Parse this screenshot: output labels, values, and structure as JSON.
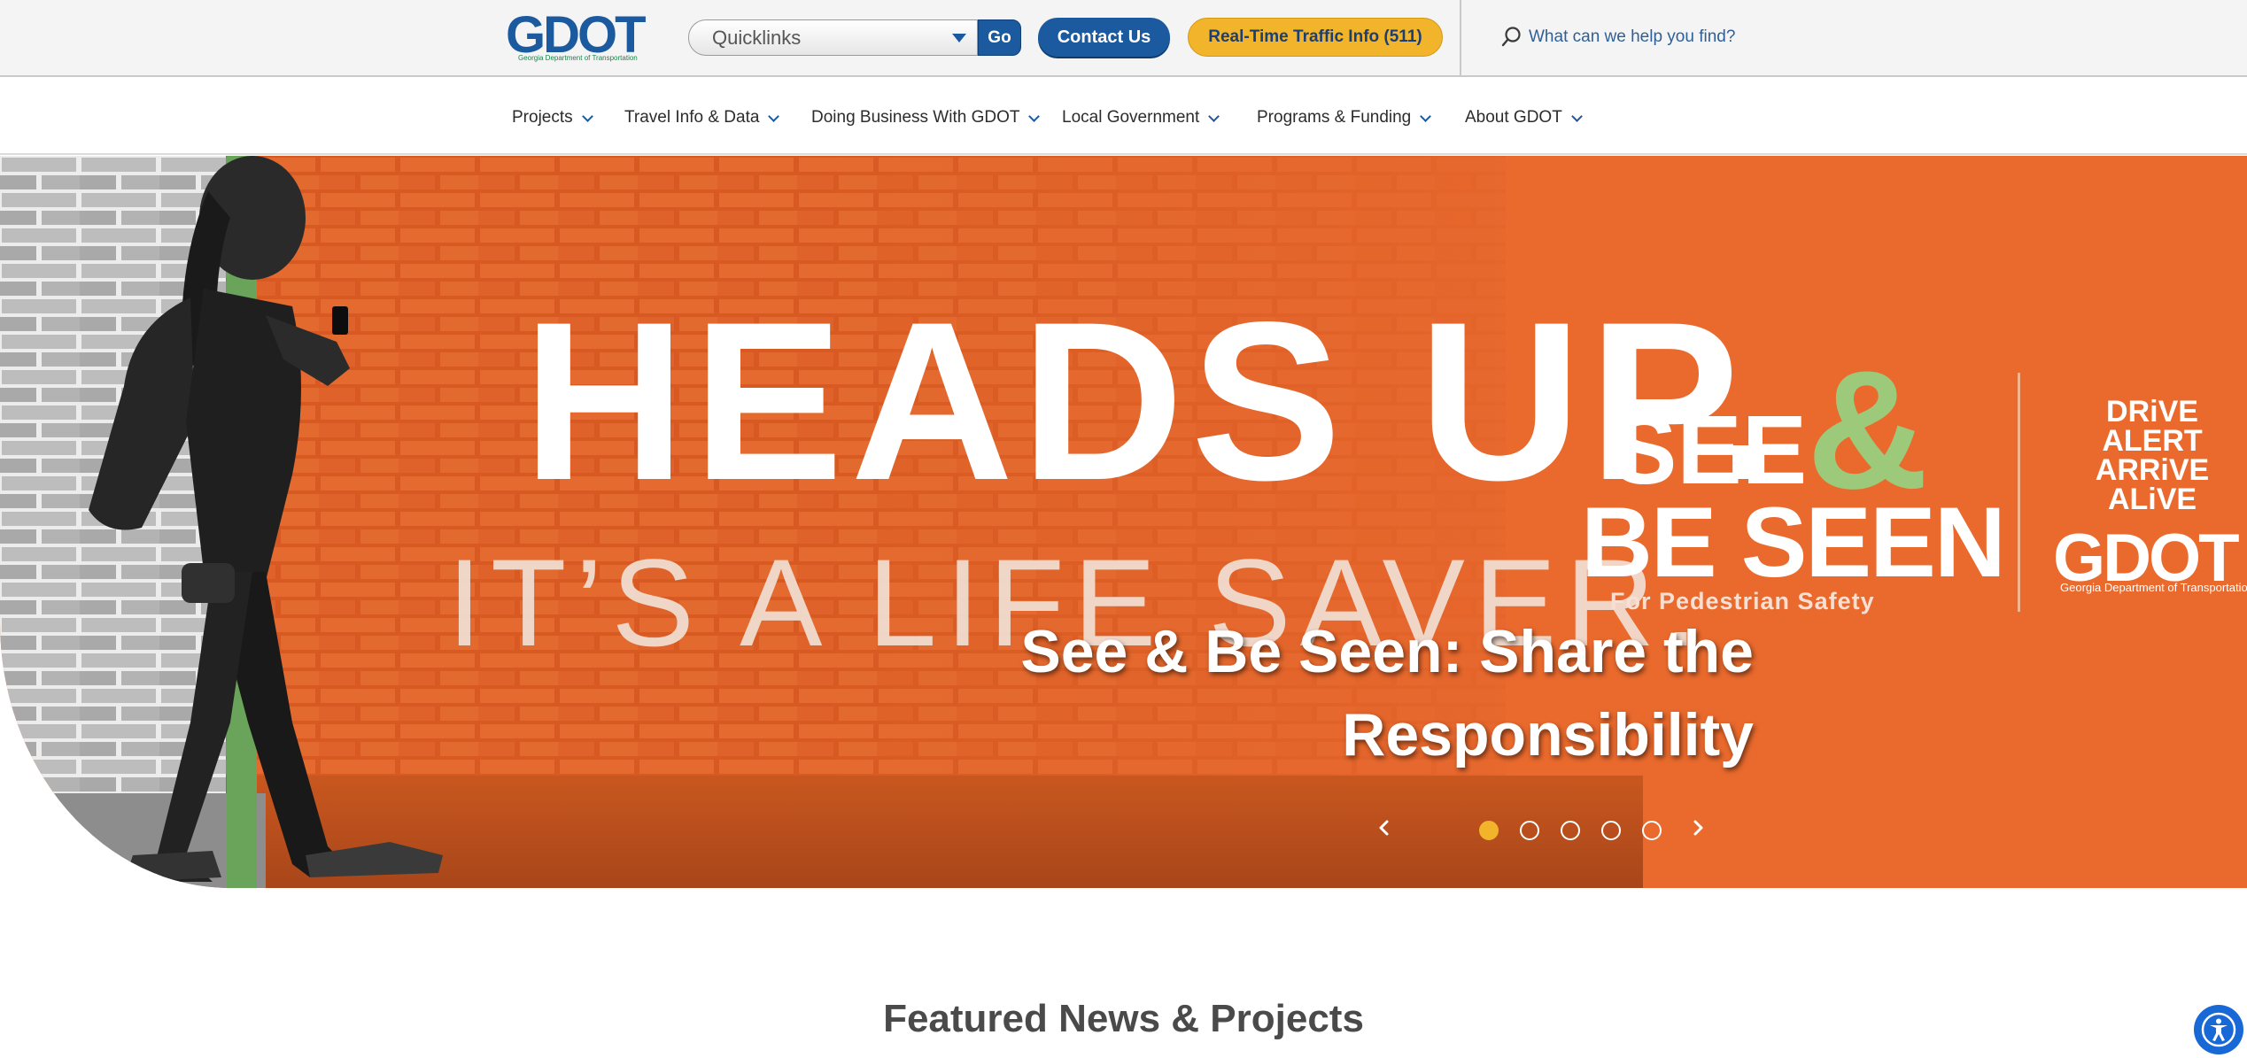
{
  "header": {
    "logo_text": "GDOT",
    "logo_subtitle": "Georgia Department of Transportation",
    "quicklinks": {
      "selected": "Quicklinks"
    },
    "go_label": "Go",
    "contact_label": "Contact Us",
    "traffic_label": "Real-Time Traffic Info (511)",
    "search": {
      "placeholder": "What can we help you find?"
    }
  },
  "nav": {
    "items": [
      {
        "label": "Projects"
      },
      {
        "label": "Travel Info & Data"
      },
      {
        "label": "Doing Business With GDOT"
      },
      {
        "label": "Local Government"
      },
      {
        "label": "Programs & Funding"
      },
      {
        "label": "About GDOT"
      }
    ]
  },
  "hero": {
    "image_text": {
      "headline": "HEADS UP.",
      "subline": "IT’S A LIFE SAVER.",
      "see": "SEE",
      "amp": "&",
      "be_seen": "BE SEEN",
      "tagline": "For Pedestrian Safety",
      "drive": [
        "DRiVE",
        "ALERT",
        "ARRiVE",
        "ALiVE"
      ],
      "logo": "GDOT",
      "logo_sub": "Georgia Department of Transportation"
    },
    "caption_line1": "See & Be Seen: Share the",
    "caption_line2": "Responsibility",
    "slide_count": 5,
    "active_slide": 1
  },
  "featured": {
    "title": "Featured News & Projects"
  },
  "colors": {
    "brand_blue": "#1c5aa0",
    "brand_yellow": "#f2b42b",
    "brand_green": "#16884a",
    "hero_orange": "#e5652a",
    "light_green": "#9cc97a"
  },
  "icons": {
    "search": "search-icon",
    "caret": "chevron-down-icon",
    "prev": "chevron-left-icon",
    "next": "chevron-right-icon",
    "accessibility": "accessibility-icon"
  }
}
